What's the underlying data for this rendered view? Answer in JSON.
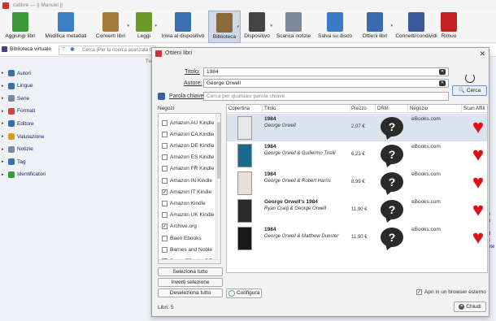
{
  "window": {
    "title": "calibre — || Manuel ||"
  },
  "toolbar": {
    "items": [
      {
        "label": "Aggiungi libri",
        "icon": "add-book-icon",
        "color": "#3a9a3a"
      },
      {
        "label": "Modifica metadati",
        "icon": "edit-metadata-icon",
        "color": "#3d7fc4"
      },
      {
        "label": "Converti libri",
        "icon": "convert-books-icon",
        "color": "#a57a3a"
      },
      {
        "label": "Leggi",
        "icon": "read-book-icon",
        "color": "#6a9a2a"
      },
      {
        "label": "Invia al dispositivo",
        "icon": "send-to-device-icon",
        "color": "#3a6fb0"
      },
      {
        "label": "Biblioteca",
        "icon": "library-icon",
        "color": "#8a6a3a"
      },
      {
        "label": "Dispositivo",
        "icon": "device-icon",
        "color": "#444444"
      },
      {
        "label": "Scarica notizie",
        "icon": "news-icon",
        "color": "#7a8a9a"
      },
      {
        "label": "Salva su disco",
        "icon": "save-disk-icon",
        "color": "#3a7ac8"
      },
      {
        "label": "Ottieni libri",
        "icon": "get-books-icon",
        "color": "#3a6ab0"
      },
      {
        "label": "Connetti/condividi",
        "icon": "connect-share-icon",
        "color": "#3a5a9a"
      },
      {
        "label": "Rimuo",
        "icon": "remove-book-icon",
        "color": "#c22222"
      }
    ]
  },
  "searchbar": {
    "virtual_library": "Biblioteca virtuale",
    "placeholder": "Cerca (Per la ricerca avanzata fai"
  },
  "sidebar": {
    "column_label": "Tu",
    "items": [
      {
        "label": "Autori",
        "icon": "authors-icon",
        "color": "#3a6fb0"
      },
      {
        "label": "Lingue",
        "icon": "languages-icon",
        "color": "#3a6fb0"
      },
      {
        "label": "Serie",
        "icon": "series-icon",
        "color": "#7a8a9a"
      },
      {
        "label": "Formati",
        "icon": "formats-icon",
        "color": "#c44"
      },
      {
        "label": "Editore",
        "icon": "publisher-icon",
        "color": "#3a6fb0"
      },
      {
        "label": "Valutazione",
        "icon": "rating-icon",
        "color": "#d8a020"
      },
      {
        "label": "Notizie",
        "icon": "news-tag-icon",
        "color": "#7a8a9a"
      },
      {
        "label": "Tag",
        "icon": "tag-icon",
        "color": "#3a6fb0"
      },
      {
        "label": "Identificatori",
        "icon": "identifiers-icon",
        "color": "#3a9a3a"
      }
    ],
    "right_cut_text": [
      "e",
      "e",
      "r",
      "d",
      "k",
      "ete",
      "."
    ]
  },
  "dialog": {
    "title": "Ottieni libri",
    "titolo_label": "Titolo:",
    "titolo_value": "1984",
    "autore_label": "Autore:",
    "autore_value": "George Orwell",
    "keyword_label": "Parola chiave:",
    "keyword_placeholder": "Cerca per qualsiasi parola chiave",
    "search_button": "Cerca",
    "stores_label": "Negozi",
    "stores": [
      {
        "name": "Amazon AU Kindle",
        "checked": false
      },
      {
        "name": "Amazon CA Kindle",
        "checked": false
      },
      {
        "name": "Amazon DE Kindle",
        "checked": false
      },
      {
        "name": "Amazon ES Kindle",
        "checked": false
      },
      {
        "name": "Amazon FR Kindle",
        "checked": false
      },
      {
        "name": "Amazon IN Kindle",
        "checked": false
      },
      {
        "name": "Amazon IT Kindle",
        "checked": true
      },
      {
        "name": "Amazon Kindle",
        "checked": false
      },
      {
        "name": "Amazon UK Kindle",
        "checked": false
      },
      {
        "name": "Archive.org",
        "checked": true
      },
      {
        "name": "Baen Ebooks",
        "checked": false
      },
      {
        "name": "Barnes and Noble",
        "checked": false
      },
      {
        "name": "Beam EBooks DE",
        "checked": false
      }
    ],
    "select_all": "Seleziona tutto",
    "invert_selection": "Inverti selezione",
    "deselect_all": "Deseleziona tutto",
    "columns": [
      "Copertina",
      "Titolo",
      "Prezzo",
      "DRM",
      "Negozio",
      "Scari Affili"
    ],
    "results": [
      {
        "title": "1984",
        "author": "George Orwell",
        "price": "2,07 €",
        "drm": "?",
        "store": "eBooks.com",
        "cover_color": "#e8e8e8",
        "selected": true
      },
      {
        "title": "1984",
        "author": "George Orwell & Guillermo Tirelli",
        "price": "6,23 €",
        "drm": "?",
        "store": "eBooks.com",
        "cover_color": "#1a6a8a",
        "selected": false
      },
      {
        "title": "1984",
        "author": "George Orwell & Robert Harris",
        "price": "8,99 €",
        "drm": "?",
        "store": "eBooks.com",
        "cover_color": "#e8e0d8",
        "selected": false
      },
      {
        "title": "George Orwell's 1984",
        "author": "Ryan Craig & George Orwell",
        "price": "11,90 €",
        "drm": "?",
        "store": "eBooks.com",
        "cover_color": "#2a2a2a",
        "selected": false
      },
      {
        "title": "1984",
        "author": "George Orwell & Matthew Dunster",
        "price": "11,90 €",
        "drm": "?",
        "store": "eBooks.com",
        "cover_color": "#1a1a1a",
        "selected": false
      }
    ],
    "configure_button": "Configura",
    "external_browser_label": "Apri in un browser esterno",
    "external_browser_checked": true,
    "books_count_label": "Libri:",
    "books_count": "5",
    "close_button": "Chiudi"
  }
}
